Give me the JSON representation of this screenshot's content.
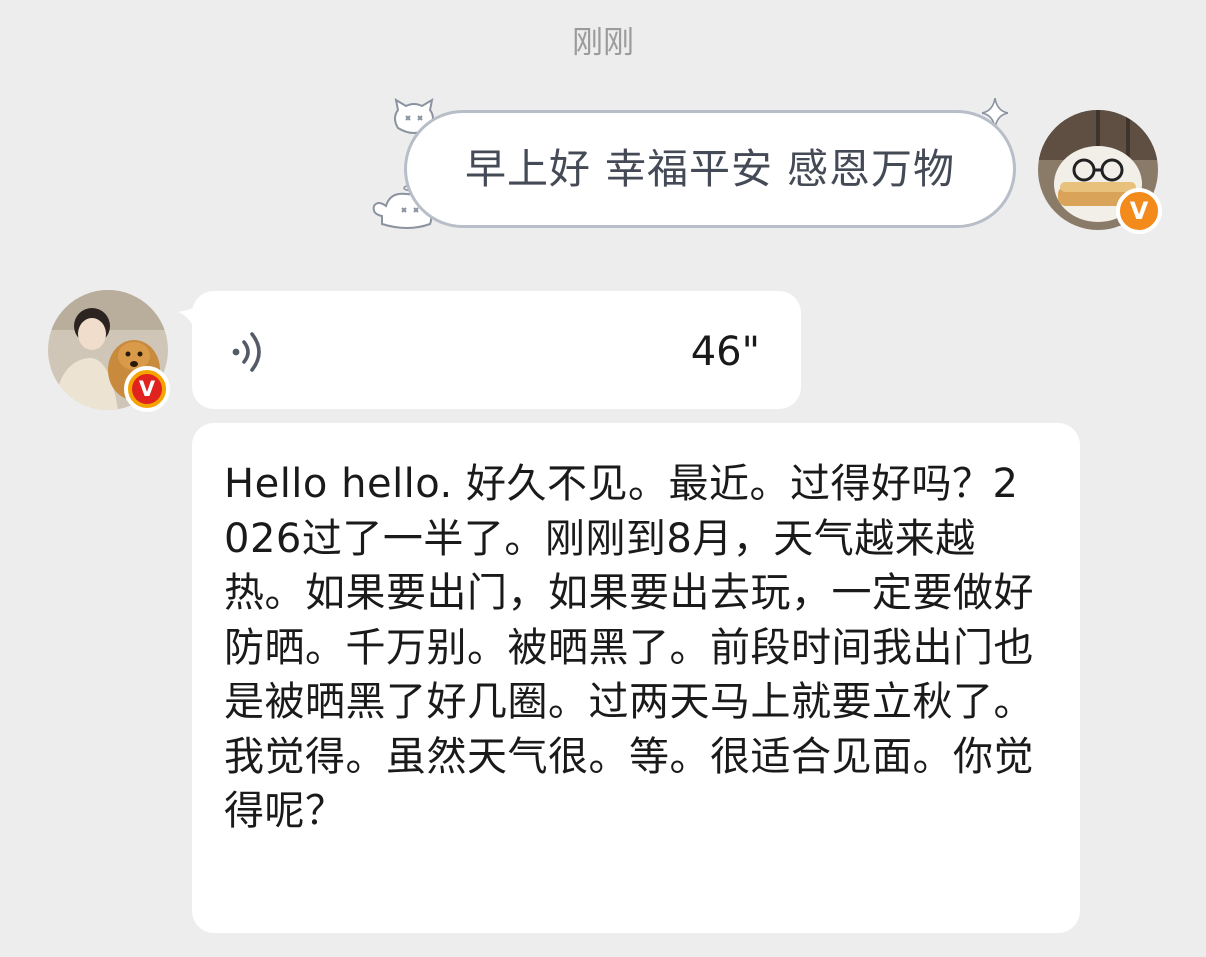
{
  "header": {
    "timestamp": "刚刚"
  },
  "messages": {
    "sent": {
      "text": "早上好 幸福平安 感恩万物",
      "avatar_icon": "cat-with-glasses-avatar",
      "badge_label": "V",
      "badge_color": "#f28a1c"
    },
    "voice": {
      "icon": "voice-wave-icon",
      "duration": "46\"",
      "avatar_icon": "person-with-dog-avatar",
      "badge_label": "V",
      "badge_color": "#e0231f"
    },
    "text": {
      "body": "Hello hello. 好久不见。最近。过得好吗？2026过了一半了。刚刚到8月，天气越来越热。如果要出门，如果要出去玩，一定要做好防晒。千万别。被晒黑了。前段时间我出门也是被晒黑了好几圈。过两天马上就要立秋了。我觉得。虽然天气很。等。很适合见面。你觉得呢？"
    }
  },
  "colors": {
    "background": "#ededed",
    "bubble": "#ffffff",
    "bubble_border": "#b8bec8",
    "timestamp": "#9b9b9b"
  }
}
